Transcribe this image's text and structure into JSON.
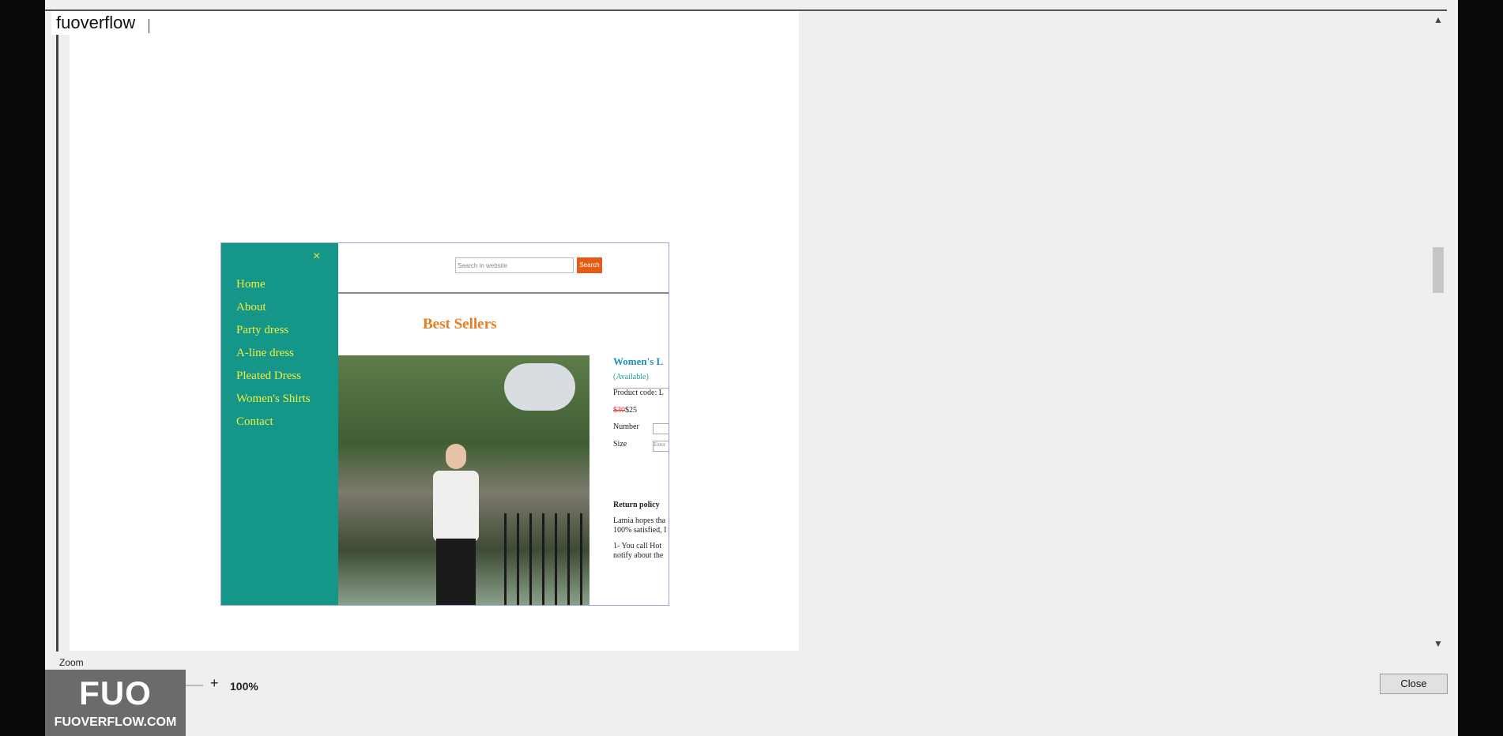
{
  "overlay": {
    "watermark_text": "fuoverflow"
  },
  "site": {
    "close_icon_glyph": "×",
    "nav": [
      "Home",
      "About",
      "Party dress",
      "A-line dress",
      "Pleated Dress",
      "Women's Shirts",
      "Contact"
    ],
    "search_placeholder": "Search in website",
    "search_button": "Search",
    "heading": "Best Sellers",
    "product": {
      "title": "Women's L",
      "availability": "(Available)",
      "product_code": "Product code: L",
      "old_price": "$30",
      "new_price": "$25",
      "number_label": "Number",
      "size_label": "Size",
      "size_placeholder": "Enter",
      "return_title": "Return policy",
      "return_text_1": "Lamia hopes tha",
      "return_text_2": "100% satisfied, I",
      "return_text_3": "1- You call Hot",
      "return_text_4": "notify about the"
    }
  },
  "controls": {
    "zoom_label": "Zoom",
    "minus": "-",
    "plus": "+",
    "zoom_value": "100%",
    "zoom_fraction": 0.5,
    "close_button": "Close"
  },
  "brand": {
    "logo_big": "FUO",
    "logo_small": "FUOVERFLOW.COM"
  }
}
